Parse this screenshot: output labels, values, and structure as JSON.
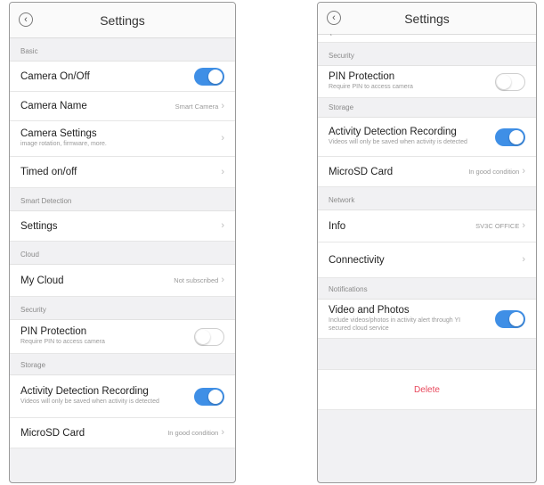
{
  "left": {
    "title": "Settings",
    "sections": [
      {
        "header": "Basic",
        "rows": [
          {
            "label": "Camera On/Off",
            "toggle": "on"
          },
          {
            "label": "Camera Name",
            "value": "Smart Camera"
          },
          {
            "label": "Camera Settings",
            "sub": "image rotation, firmware, more."
          },
          {
            "label": "Timed on/off"
          }
        ]
      },
      {
        "header": "Smart Detection",
        "rows": [
          {
            "label": "Settings"
          }
        ]
      },
      {
        "header": "Cloud",
        "rows": [
          {
            "label": "My Cloud",
            "value": "Not subscribed"
          }
        ]
      },
      {
        "header": "Security",
        "rows": [
          {
            "label": "PIN Protection",
            "sub": "Require PIN to access camera",
            "toggle": "off"
          }
        ]
      },
      {
        "header": "Storage",
        "rows": [
          {
            "label": "Activity Detection Recording",
            "sub": "Videos will only be saved when activity is detected",
            "toggle": "on"
          },
          {
            "label": "MicroSD Card",
            "value": "In good condition"
          }
        ]
      }
    ]
  },
  "right": {
    "title": "Settings",
    "sections": [
      {
        "header": "Security",
        "rows": [
          {
            "label": "PIN Protection",
            "sub": "Require PIN to access camera",
            "toggle": "off"
          }
        ]
      },
      {
        "header": "Storage",
        "rows": [
          {
            "label": "Activity Detection Recording",
            "sub": "Videos will only be saved when activity is detected",
            "toggle": "on"
          },
          {
            "label": "MicroSD Card",
            "value": "In good condition"
          }
        ]
      },
      {
        "header": "Network",
        "rows": [
          {
            "label": "Info",
            "value": "SV3C OFFICE"
          },
          {
            "label": "Connectivity"
          }
        ]
      },
      {
        "header": "Notifications",
        "rows": [
          {
            "label": "Video and Photos",
            "sub": "Include videos/photos in activity alert through YI secured cloud service",
            "toggle": "on"
          }
        ]
      }
    ],
    "delete_label": "Delete"
  },
  "colors": {
    "accent": "#3f8fe6",
    "danger": "#e8485c",
    "background": "#f1f1f3"
  },
  "icons": {
    "back": "back-icon",
    "chevron": "chevron-right-icon"
  }
}
